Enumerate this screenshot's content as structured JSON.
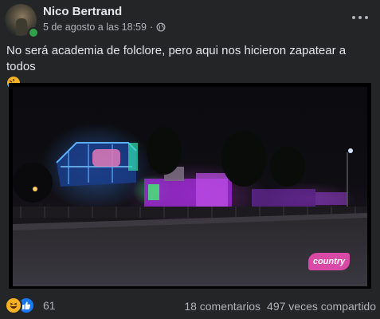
{
  "post": {
    "author": "Nico Bertrand",
    "timestamp": "5 de agosto a las 18:59",
    "separator": "·",
    "privacy_icon": "globe-icon",
    "menu_icon": "more-options-icon",
    "caption": "No será academia de folclore, pero aqui nos hicieron zapatear a todos",
    "caption_emoji": "rolling-on-floor-laughing-emoji"
  },
  "media": {
    "watermark": "country"
  },
  "footer": {
    "reaction_icons": [
      "haha-icon",
      "like-icon"
    ],
    "reaction_count": "61",
    "comments": "18 comentarios",
    "shares": "497 veces compartido"
  },
  "colors": {
    "background": "#242526",
    "primary_text": "#e4e6eb",
    "secondary_text": "#b0b3b8",
    "online": "#31a24c",
    "like": "#1877f2",
    "haha": "#f7b125",
    "watermark": "#d94aa6"
  }
}
